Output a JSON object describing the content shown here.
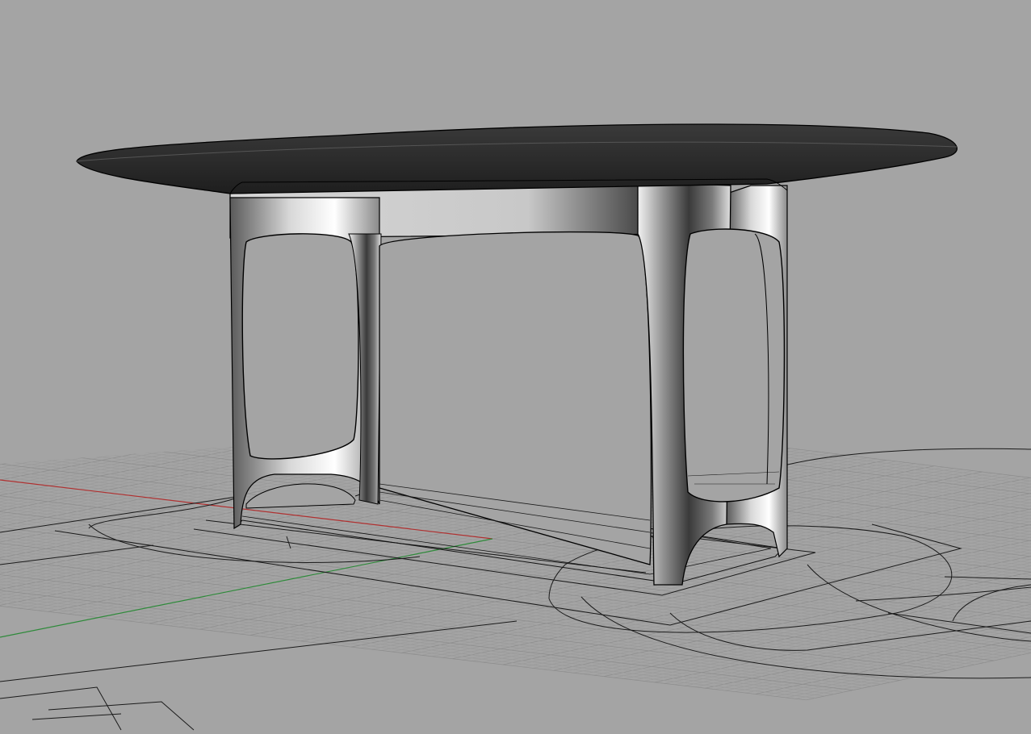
{
  "viewport": {
    "label": "",
    "background": "#a4a4a4",
    "grid_color": "#9a9a9a",
    "grid_major_color": "#8c8c8c",
    "x_axis_color": "#c0392b",
    "y_axis_color": "#2e9a3a",
    "curve_color": "#1a1a1a"
  },
  "model": {
    "object": "table",
    "top_color": "#2b2b2b",
    "body_color": "#c8c8c8",
    "edge_color": "#000000"
  }
}
